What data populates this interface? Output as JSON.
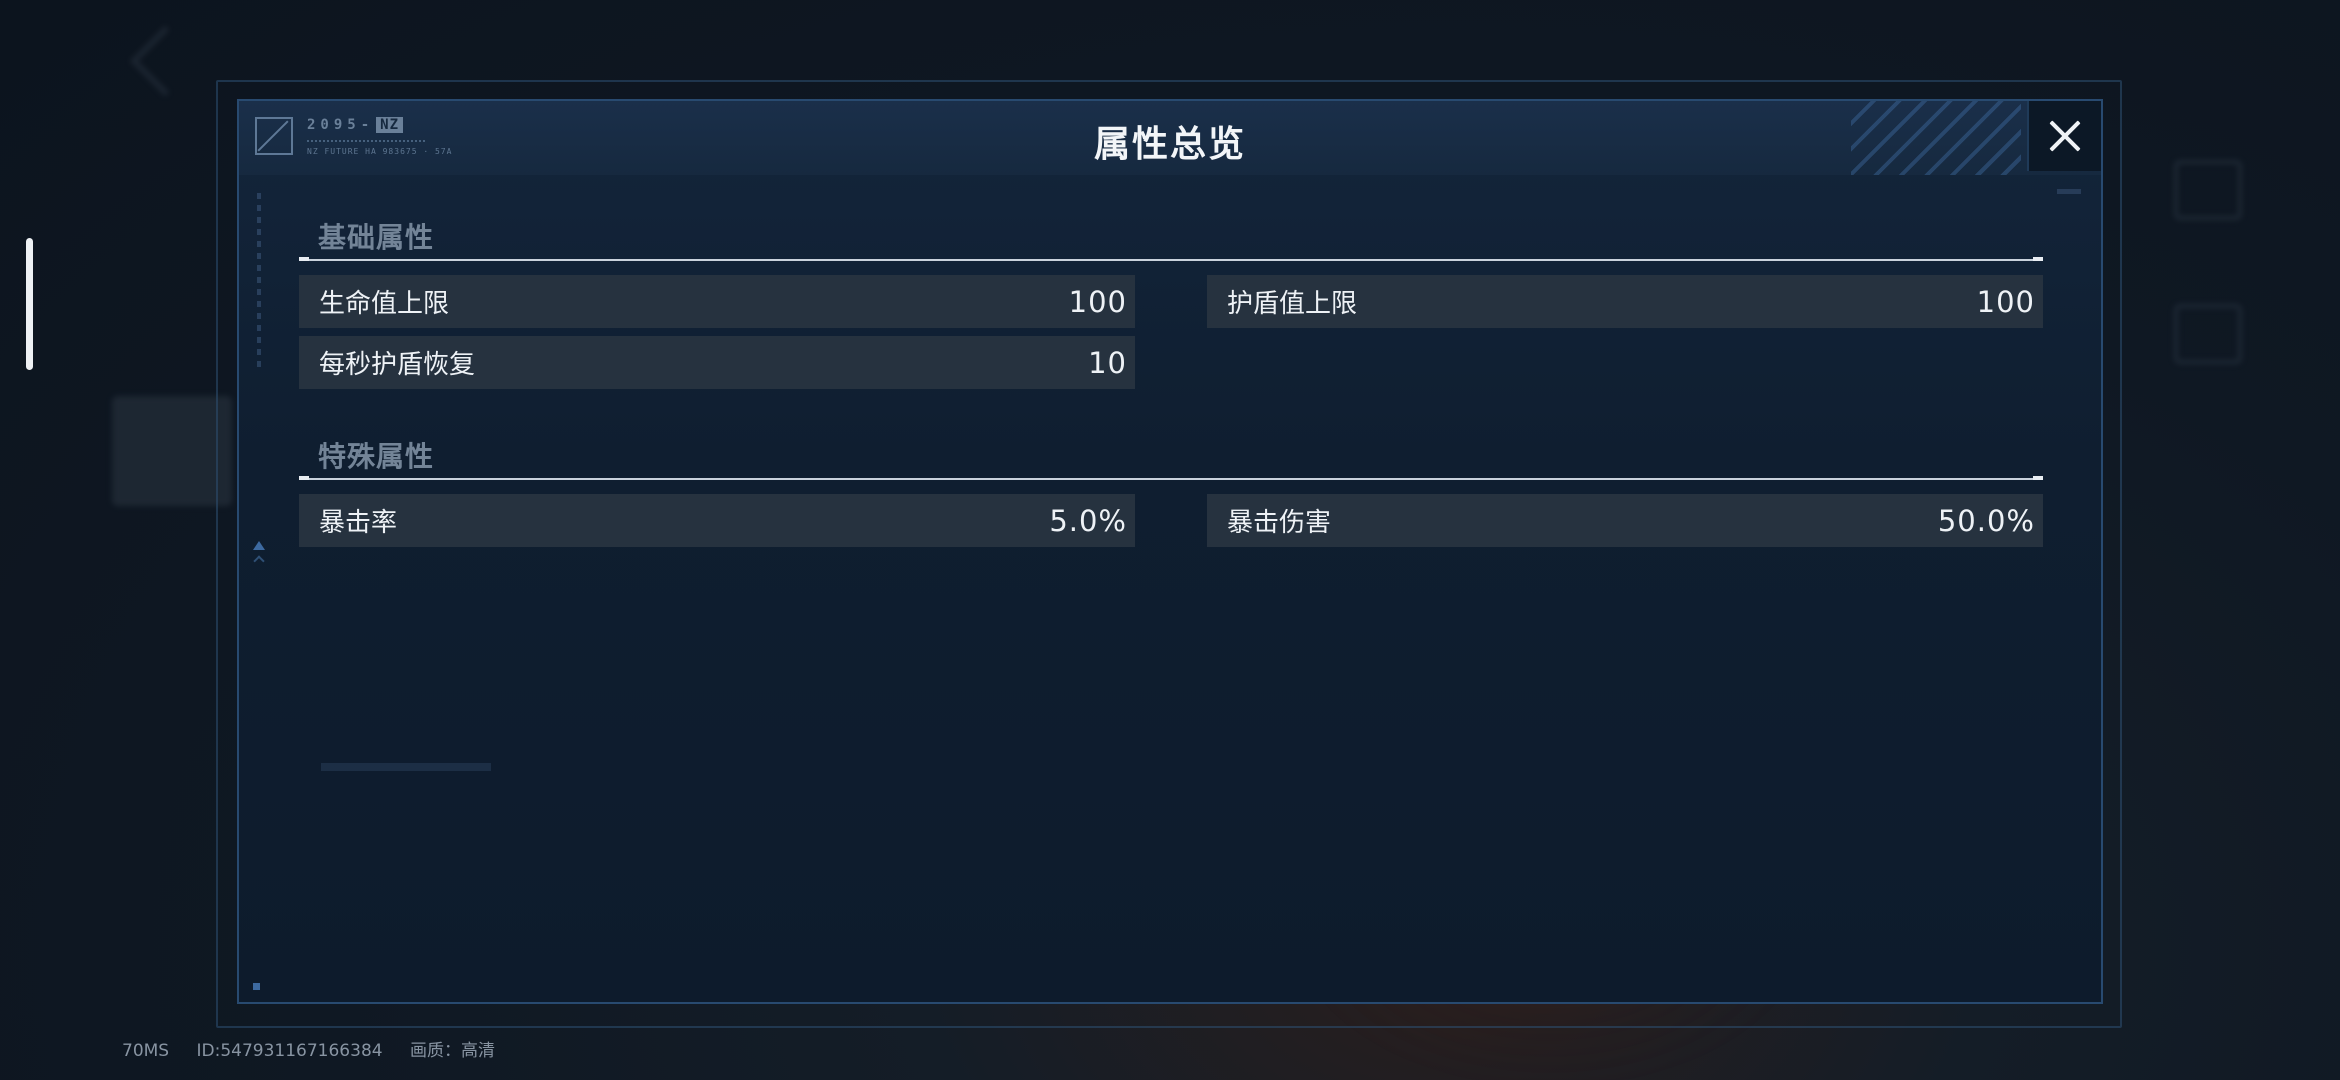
{
  "modal": {
    "title": "属性总览",
    "logo": {
      "code": "2095-",
      "badge": "NZ",
      "subtitle": "NZ FUTURE HA 983675 · 57A"
    },
    "sections": [
      {
        "title": "基础属性",
        "stats": [
          {
            "label": "生命值上限",
            "value": "100"
          },
          {
            "label": "护盾值上限",
            "value": "100"
          },
          {
            "label": "每秒护盾恢复",
            "value": "10"
          }
        ]
      },
      {
        "title": "特殊属性",
        "stats": [
          {
            "label": "暴击率",
            "value": "5.0%"
          },
          {
            "label": "暴击伤害",
            "value": "50.0%"
          }
        ]
      }
    ]
  },
  "status_bar": {
    "latency": "70MS",
    "user_id": "ID:547931167166384",
    "quality": "画质：高清"
  },
  "colors": {
    "modal_border": "#284a70",
    "stat_row_bg": "#26323f",
    "section_title": "#738497",
    "accent_blue": "#3d6aa0"
  },
  "icons": {
    "close": "close-icon",
    "logo": "slash-box-icon"
  }
}
